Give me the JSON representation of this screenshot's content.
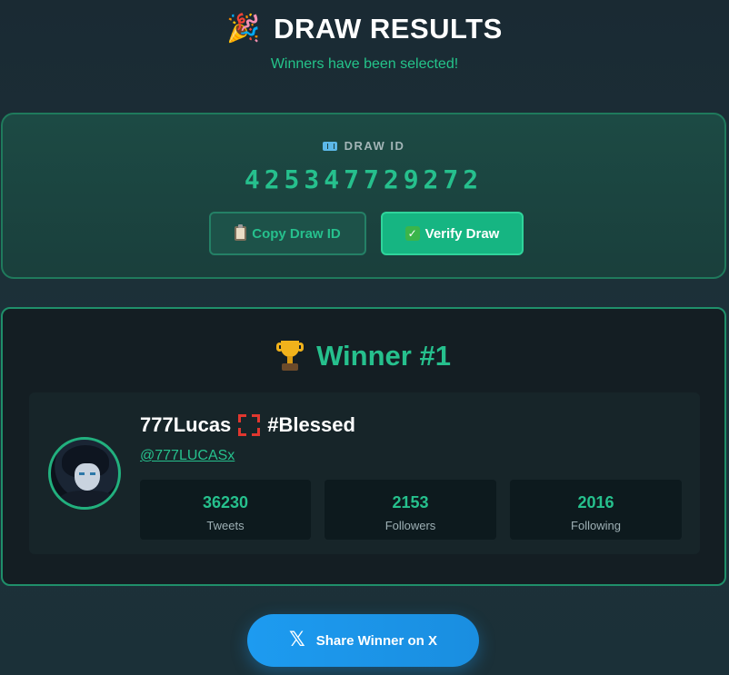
{
  "header": {
    "title": "DRAW RESULTS",
    "title_icon": "party-popper-icon",
    "subtitle": "Winners have been selected!"
  },
  "draw": {
    "label": "DRAW ID",
    "label_icon": "ticket-icon",
    "id": "425347729272",
    "copy_button": "Copy Draw ID",
    "copy_icon": "clipboard-icon",
    "verify_button": "Verify Draw",
    "verify_icon": "check-icon"
  },
  "winner": {
    "title": "Winner #1",
    "title_icon": "trophy-icon",
    "display_name": "777Lucas",
    "name_icon": "anger-symbol-icon",
    "name_suffix": "#Blessed",
    "handle": "@777LUCASx",
    "stats": [
      {
        "value": "36230",
        "label": "Tweets"
      },
      {
        "value": "2153",
        "label": "Followers"
      },
      {
        "value": "2016",
        "label": "Following"
      }
    ]
  },
  "share": {
    "label": "Share Winner on X",
    "icon": "x-logo-icon"
  },
  "colors": {
    "accent": "#26c08d",
    "share_blue": "#1d9bf0",
    "background": "#1a2a33"
  }
}
